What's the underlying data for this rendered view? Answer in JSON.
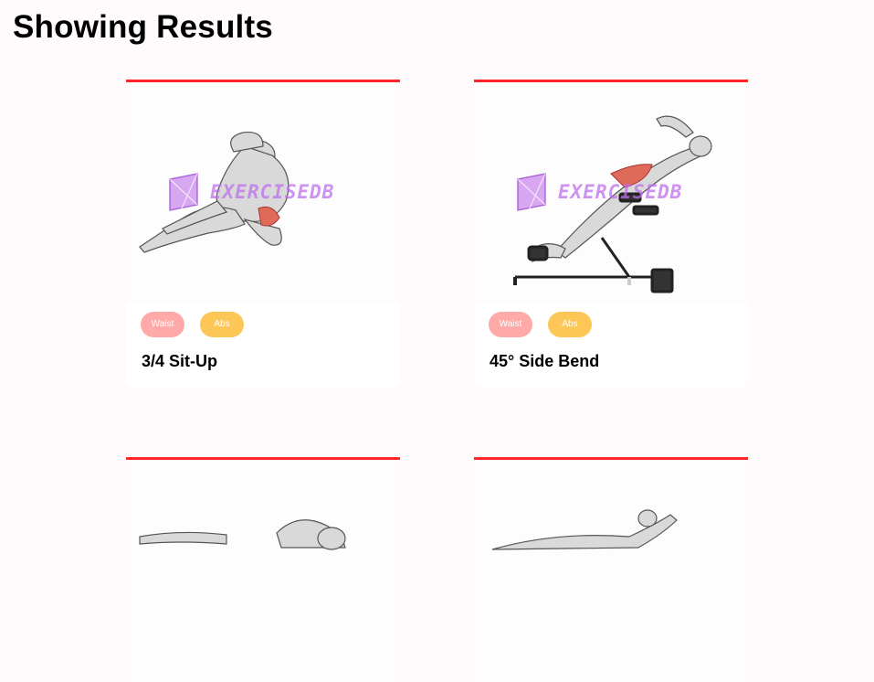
{
  "page": {
    "heading": "Showing Results"
  },
  "colors": {
    "card_border": "#ff2625",
    "body_part_tag": "#ffa9a9",
    "target_tag": "#fcc757"
  },
  "watermark": {
    "text": "EXERCISEDB",
    "icon": "exercisedb-logo-icon"
  },
  "exercises": [
    {
      "name": "3/4 Sit-Up",
      "body_part": "Waist",
      "target": "Abs",
      "image_icon": "sit-up-illustration"
    },
    {
      "name": "45° Side Bend",
      "body_part": "Waist",
      "target": "Abs",
      "image_icon": "side-bend-illustration"
    },
    {
      "name": "",
      "body_part": "",
      "target": "",
      "image_icon": "crunch-illustration"
    },
    {
      "name": "",
      "body_part": "",
      "target": "",
      "image_icon": "leg-raise-illustration"
    }
  ]
}
